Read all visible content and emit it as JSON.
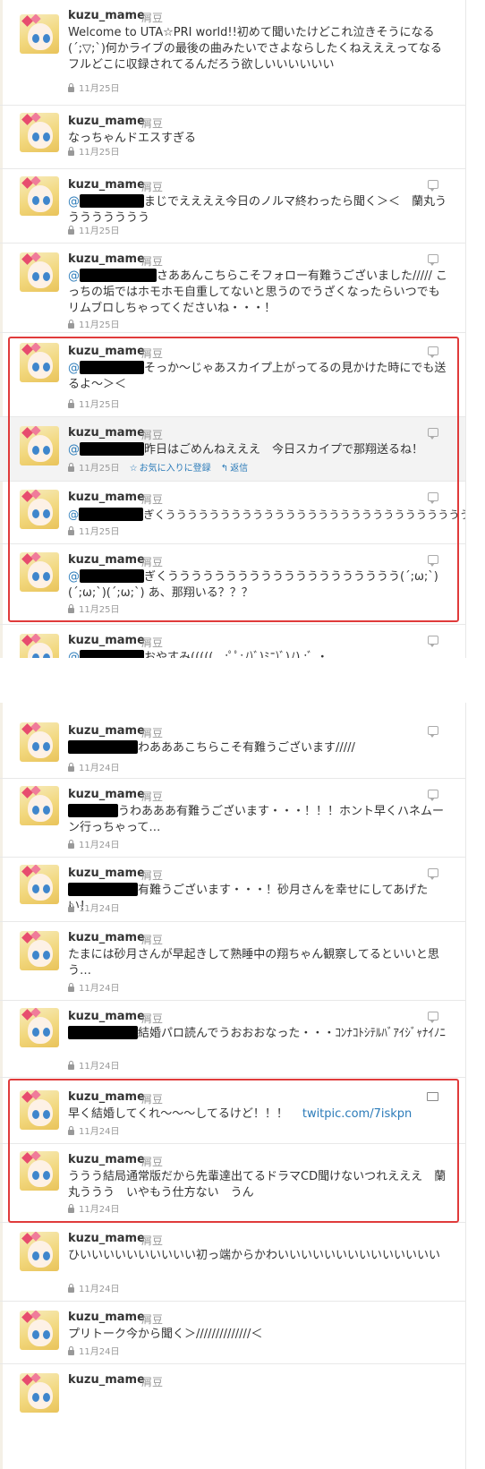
{
  "user": {
    "username": "kuzu_mame",
    "screen_name": "屑豆"
  },
  "section1": {
    "tweets": [
      {
        "text": "Welcome to UTA☆PRI world!!初めて聞いたけどこれ泣きそうになる(´;▽;`)何かライブの最後の曲みたいでさよならしたくねえええってなる フルどこに収録されてるんだろう欲しいいいいいい",
        "time": "11月25日"
      },
      {
        "text": "なっちゃんドエスすぎる",
        "time": "11月25日"
      },
      {
        "mention": "@",
        "text": "まじでええええ今日のノルマ終わったら聞く＞＜　蘭丸うううううううう",
        "time": "11月25日"
      },
      {
        "mention": "@",
        "text": "さああんこちらこそフォロー有難うございました///// こっちの垢ではホモホモ自重してないと思うのでうざくなったらいつでもリムブロしちゃってくださいね・・・！",
        "time": "11月25日"
      },
      {
        "mention": "@",
        "text": "そっか〜じゃあスカイプ上がってるの見かけた時にでも送るよ〜＞＜",
        "time": "11月25日"
      },
      {
        "mention": "@",
        "text": "昨日はごめんねえええ　今日スカイプで那翔送るね！",
        "time": "11月25日",
        "favorite": "お気に入りに登録",
        "reply": "返信"
      },
      {
        "mention": "@",
        "text": "ぎくうううううううううううううううううううううううううううう",
        "time": "11月25日"
      },
      {
        "mention": "@",
        "text": "ぎくうううううううううううううううううううう(´;ω;`)(´;ω;`)(´;ω;`) あ、那翔いる？？？",
        "time": "11月25日"
      },
      {
        "mention": "@",
        "text": "おやすみ(((((　;ﾟﾟ;ﾉ)ﾞ)ﾐﾆ)ﾞ)ﾉ) ;ﾞ ・",
        "time": ""
      }
    ]
  },
  "section2": {
    "tweets": [
      {
        "text": "わあああこちらこそ有難うございます/////",
        "time": "11月24日"
      },
      {
        "text": "うわあああ有難うございます・・・！！！ホント早くハネムーン行っちゃって…",
        "time": "11月24日"
      },
      {
        "text": "有難うございます・・・！砂月さんを幸せにしてあげたい！",
        "time": "11月24日"
      },
      {
        "text": "たまには砂月さんが早起きして熟睡中の翔ちゃん観察してるといいと思う…",
        "time": "11月24日"
      },
      {
        "text": "結婚パロ読んでうおおおなった・・・ｺﾝﾅｺﾄｼﾃﾙﾊﾞｱｲｼﾞｬﾅｲﾉﾆ",
        "time": "11月24日"
      },
      {
        "text": "早く結婚してくれ〜〜〜してるけど！！！",
        "link": "twitpic.com/7iskpn",
        "time": "11月24日"
      },
      {
        "text": "ううう結局通常版だから先輩達出てるドラマCD聞けないつれえええ　蘭丸ううう　いやもう仕方ない　うん",
        "time": "11月24日"
      },
      {
        "text": "ひいいいいいいいいいい初っ端からかわいいいいいいいいいいいいいい",
        "time": "11月24日"
      },
      {
        "text": "プリトーク今から聞く＞//////////////＜",
        "time": "11月24日"
      }
    ]
  }
}
